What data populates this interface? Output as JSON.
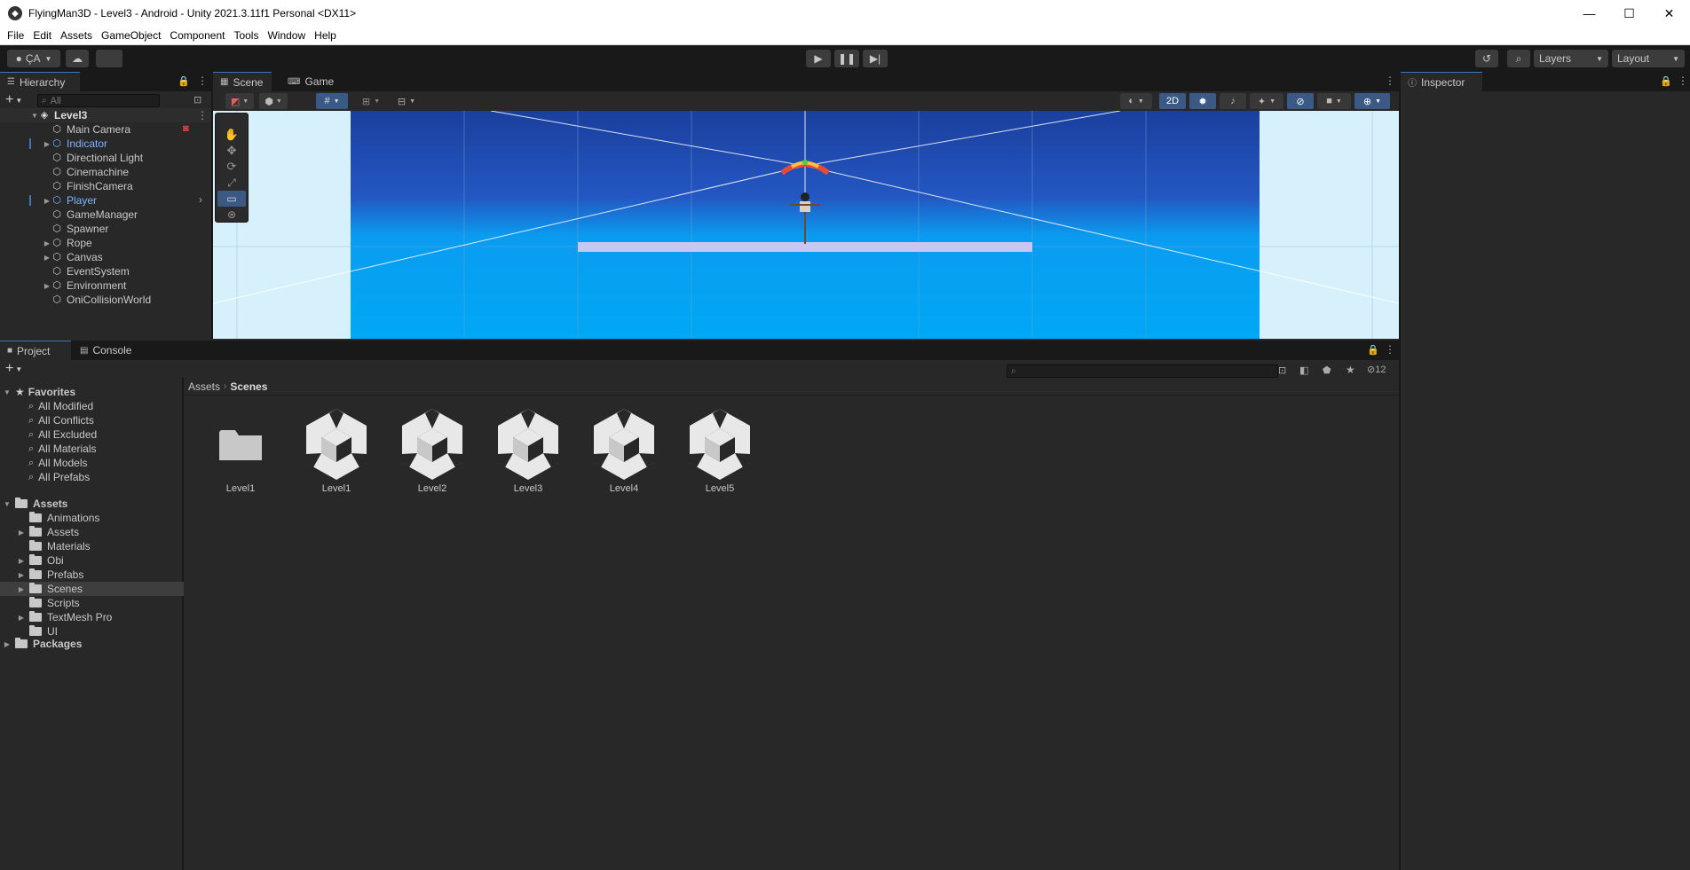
{
  "window": {
    "title": "FlyingMan3D - Level3 - Android - Unity 2021.3.11f1 Personal <DX11>",
    "minimize": "—",
    "maximize": "☐",
    "close": "✕"
  },
  "menu": [
    "File",
    "Edit",
    "Assets",
    "GameObject",
    "Component",
    "Tools",
    "Window",
    "Help"
  ],
  "toolbar": {
    "account_label": "ÇA",
    "layers_label": "Layers",
    "layout_label": "Layout"
  },
  "hierarchy": {
    "tab_label": "Hierarchy",
    "search_placeholder": "All",
    "scene_name": "Level3",
    "items": [
      {
        "label": "Main Camera",
        "expandable": false,
        "prefab": false
      },
      {
        "label": "Indicator",
        "expandable": true,
        "prefab": true
      },
      {
        "label": "Directional Light",
        "expandable": false,
        "prefab": false
      },
      {
        "label": "Cinemachine",
        "expandable": false,
        "prefab": false
      },
      {
        "label": "FinishCamera",
        "expandable": false,
        "prefab": false
      },
      {
        "label": "Player",
        "expandable": true,
        "prefab": true
      },
      {
        "label": "GameManager",
        "expandable": false,
        "prefab": false
      },
      {
        "label": "Spawner",
        "expandable": false,
        "prefab": false
      },
      {
        "label": "Rope",
        "expandable": true,
        "prefab": false
      },
      {
        "label": "Canvas",
        "expandable": true,
        "prefab": false
      },
      {
        "label": "EventSystem",
        "expandable": false,
        "prefab": false
      },
      {
        "label": "Environment",
        "expandable": true,
        "prefab": false
      },
      {
        "label": "OniCollisionWorld",
        "expandable": false,
        "prefab": false
      }
    ]
  },
  "scene_view": {
    "tab_scene": "Scene",
    "tab_game": "Game",
    "mode_2d": "2D"
  },
  "inspector": {
    "tab_label": "Inspector"
  },
  "project": {
    "tab_project": "Project",
    "tab_console": "Console",
    "hidden_count": "12",
    "breadcrumb": [
      "Assets",
      "Scenes"
    ],
    "favorites_label": "Favorites",
    "favorites": [
      "All Modified",
      "All Conflicts",
      "All Excluded",
      "All Materials",
      "All Models",
      "All Prefabs"
    ],
    "assets_label": "Assets",
    "asset_folders": [
      {
        "label": "Animations",
        "expandable": false
      },
      {
        "label": "Assets",
        "expandable": true
      },
      {
        "label": "Materials",
        "expandable": false
      },
      {
        "label": "Obi",
        "expandable": true
      },
      {
        "label": "Prefabs",
        "expandable": true
      },
      {
        "label": "Scenes",
        "expandable": true
      },
      {
        "label": "Scripts",
        "expandable": false
      },
      {
        "label": "TextMesh Pro",
        "expandable": true
      },
      {
        "label": "UI",
        "expandable": false
      }
    ],
    "packages_label": "Packages",
    "grid_items": [
      {
        "label": "Level1",
        "kind": "folder"
      },
      {
        "label": "Level1",
        "kind": "scene"
      },
      {
        "label": "Level2",
        "kind": "scene"
      },
      {
        "label": "Level3",
        "kind": "scene"
      },
      {
        "label": "Level4",
        "kind": "scene"
      },
      {
        "label": "Level5",
        "kind": "scene"
      }
    ]
  },
  "colors": {
    "accent": "#3a79bb",
    "prefab_blue": "#7cb4ff",
    "sky_top": "#1a3f9e",
    "sky_bottom": "#00a8f5"
  }
}
